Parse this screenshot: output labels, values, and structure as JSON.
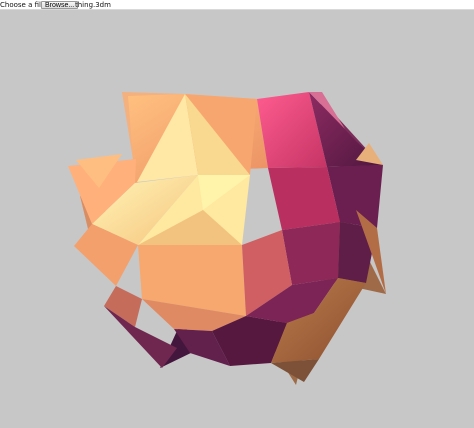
{
  "top_bar": {
    "file_label": "Choose a file:",
    "browse_button": "Browse...",
    "selected_file": "thing.3dm"
  },
  "viewport": {
    "background": "#c7c7c7",
    "model_palette": [
      "#fff0a6",
      "#f8c77f",
      "#f09a6c",
      "#ff4f86",
      "#9a2e64",
      "#5d1d4a",
      "#b77a4a"
    ]
  }
}
